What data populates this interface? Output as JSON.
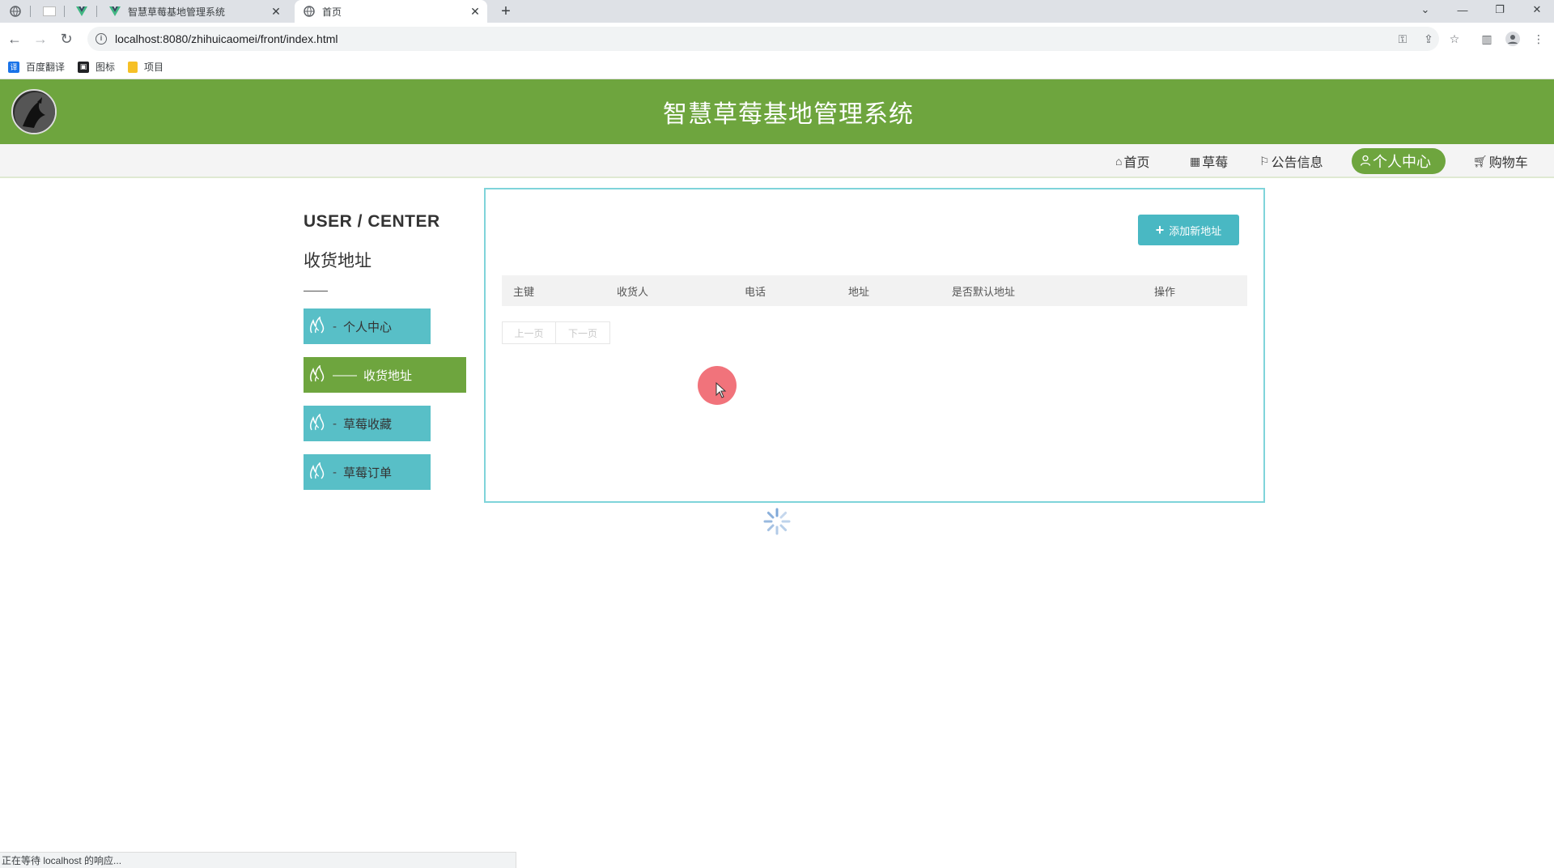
{
  "browser": {
    "tabs": [
      {
        "title": "智慧草莓基地管理系统",
        "active": false
      },
      {
        "title": "首页",
        "active": true
      }
    ],
    "new_tab": "+",
    "url": "localhost:8080/zhihuicaomei/front/index.html",
    "bookmarks": [
      {
        "label": "百度翻译",
        "icon": "translate-icon",
        "color": "#1a73e8"
      },
      {
        "label": "图标",
        "icon": "image-icon",
        "color": "#202124"
      },
      {
        "label": "项目",
        "icon": "folder-icon",
        "color": "#f6c026"
      }
    ],
    "status_text": "正在等待 localhost 的响应..."
  },
  "site": {
    "title": "智慧草莓基地管理系统",
    "brand_color": "#6ea53e",
    "accent_color": "#58bfc7",
    "nav": [
      {
        "label": "首页",
        "icon": "home-icon",
        "active": false
      },
      {
        "label": "草莓",
        "icon": "grid-icon",
        "active": false
      },
      {
        "label": "公告信息",
        "icon": "flag-icon",
        "active": false
      },
      {
        "label": "个人中心",
        "icon": "user-icon",
        "active": true
      },
      {
        "label": "购物车",
        "icon": "cart-icon",
        "active": false
      }
    ]
  },
  "sidebar": {
    "heading": "USER / CENTER",
    "subheading": "收货地址",
    "items": [
      {
        "label": "个人中心",
        "dash": "-",
        "active": false
      },
      {
        "label": "收货地址",
        "dash": "——",
        "active": true
      },
      {
        "label": "草莓收藏",
        "dash": "-",
        "active": false
      },
      {
        "label": "草莓订单",
        "dash": "-",
        "active": false
      }
    ]
  },
  "main": {
    "add_button": "添加新地址",
    "columns": [
      "主键",
      "收货人",
      "电话",
      "地址",
      "是否默认地址",
      "操作"
    ],
    "rows": [],
    "pager": {
      "prev": "上一页",
      "next": "下一页"
    }
  }
}
